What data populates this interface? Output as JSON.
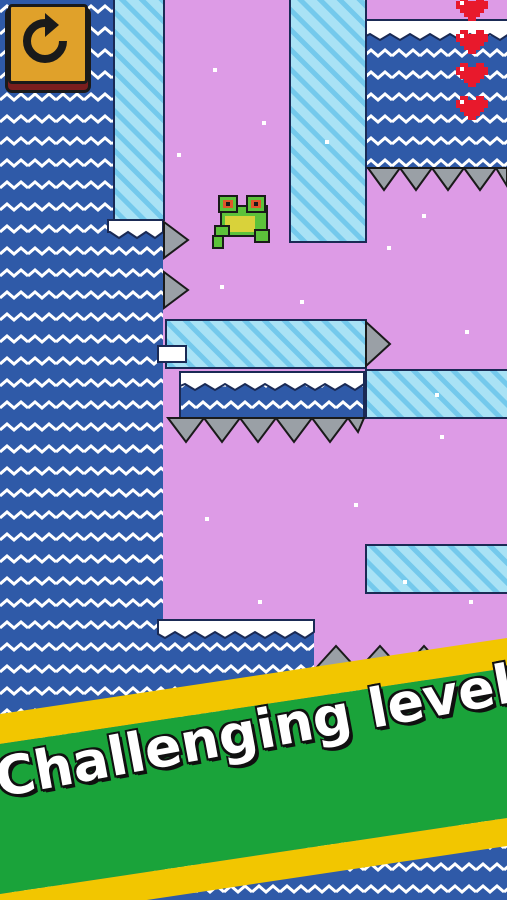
{
  "hud": {
    "restart_icon": "restart-arrow-icon",
    "lives": 4,
    "heart_icon": "heart-icon"
  },
  "banner": {
    "text": "Challenging levels!"
  },
  "colors": {
    "water": "#2f5aa8",
    "wave": "#ffffff",
    "sky": "#dd9be6",
    "ice": "#a9e2f5",
    "ice_stripe": "#6ec8ea",
    "snow": "#ffffff",
    "spike": "#9aa0a6",
    "banner_green": "#1aa33a",
    "banner_yellow": "#f2c600",
    "button": "#e0a12a",
    "heart": "#e8192c",
    "frog": "#5cc23a"
  }
}
